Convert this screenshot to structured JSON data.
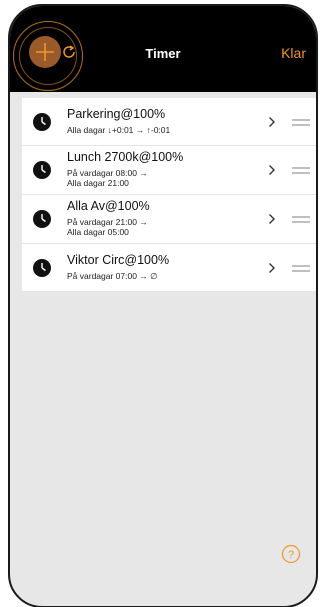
{
  "header": {
    "title": "Timer",
    "done_label": "Klar"
  },
  "icons": {
    "add": "plus-icon",
    "sync": "refresh-icon",
    "timer": "clock-icon",
    "disclosure": "chevron-right-icon",
    "reorder": "drag-handle-icon",
    "help": "help-icon"
  },
  "colors": {
    "accent": "#f0952a",
    "navbar": "#000000",
    "background": "#e7e7e7"
  },
  "timers": [
    {
      "name": "Parkering@100%",
      "line1": "Alla dagar ↓+0:01 → ↑-0:01",
      "line2": ""
    },
    {
      "name": "Lunch 2700k@100%",
      "line1": "På vardagar 08:00 →",
      "line2": "Alla dagar 21:00"
    },
    {
      "name": "Alla Av@100%",
      "line1": "På vardagar 21:00 →",
      "line2": "Alla dagar 05:00"
    },
    {
      "name": "Viktor Circ@100%",
      "line1": "På vardagar 07:00 → ∅",
      "line2": ""
    }
  ]
}
